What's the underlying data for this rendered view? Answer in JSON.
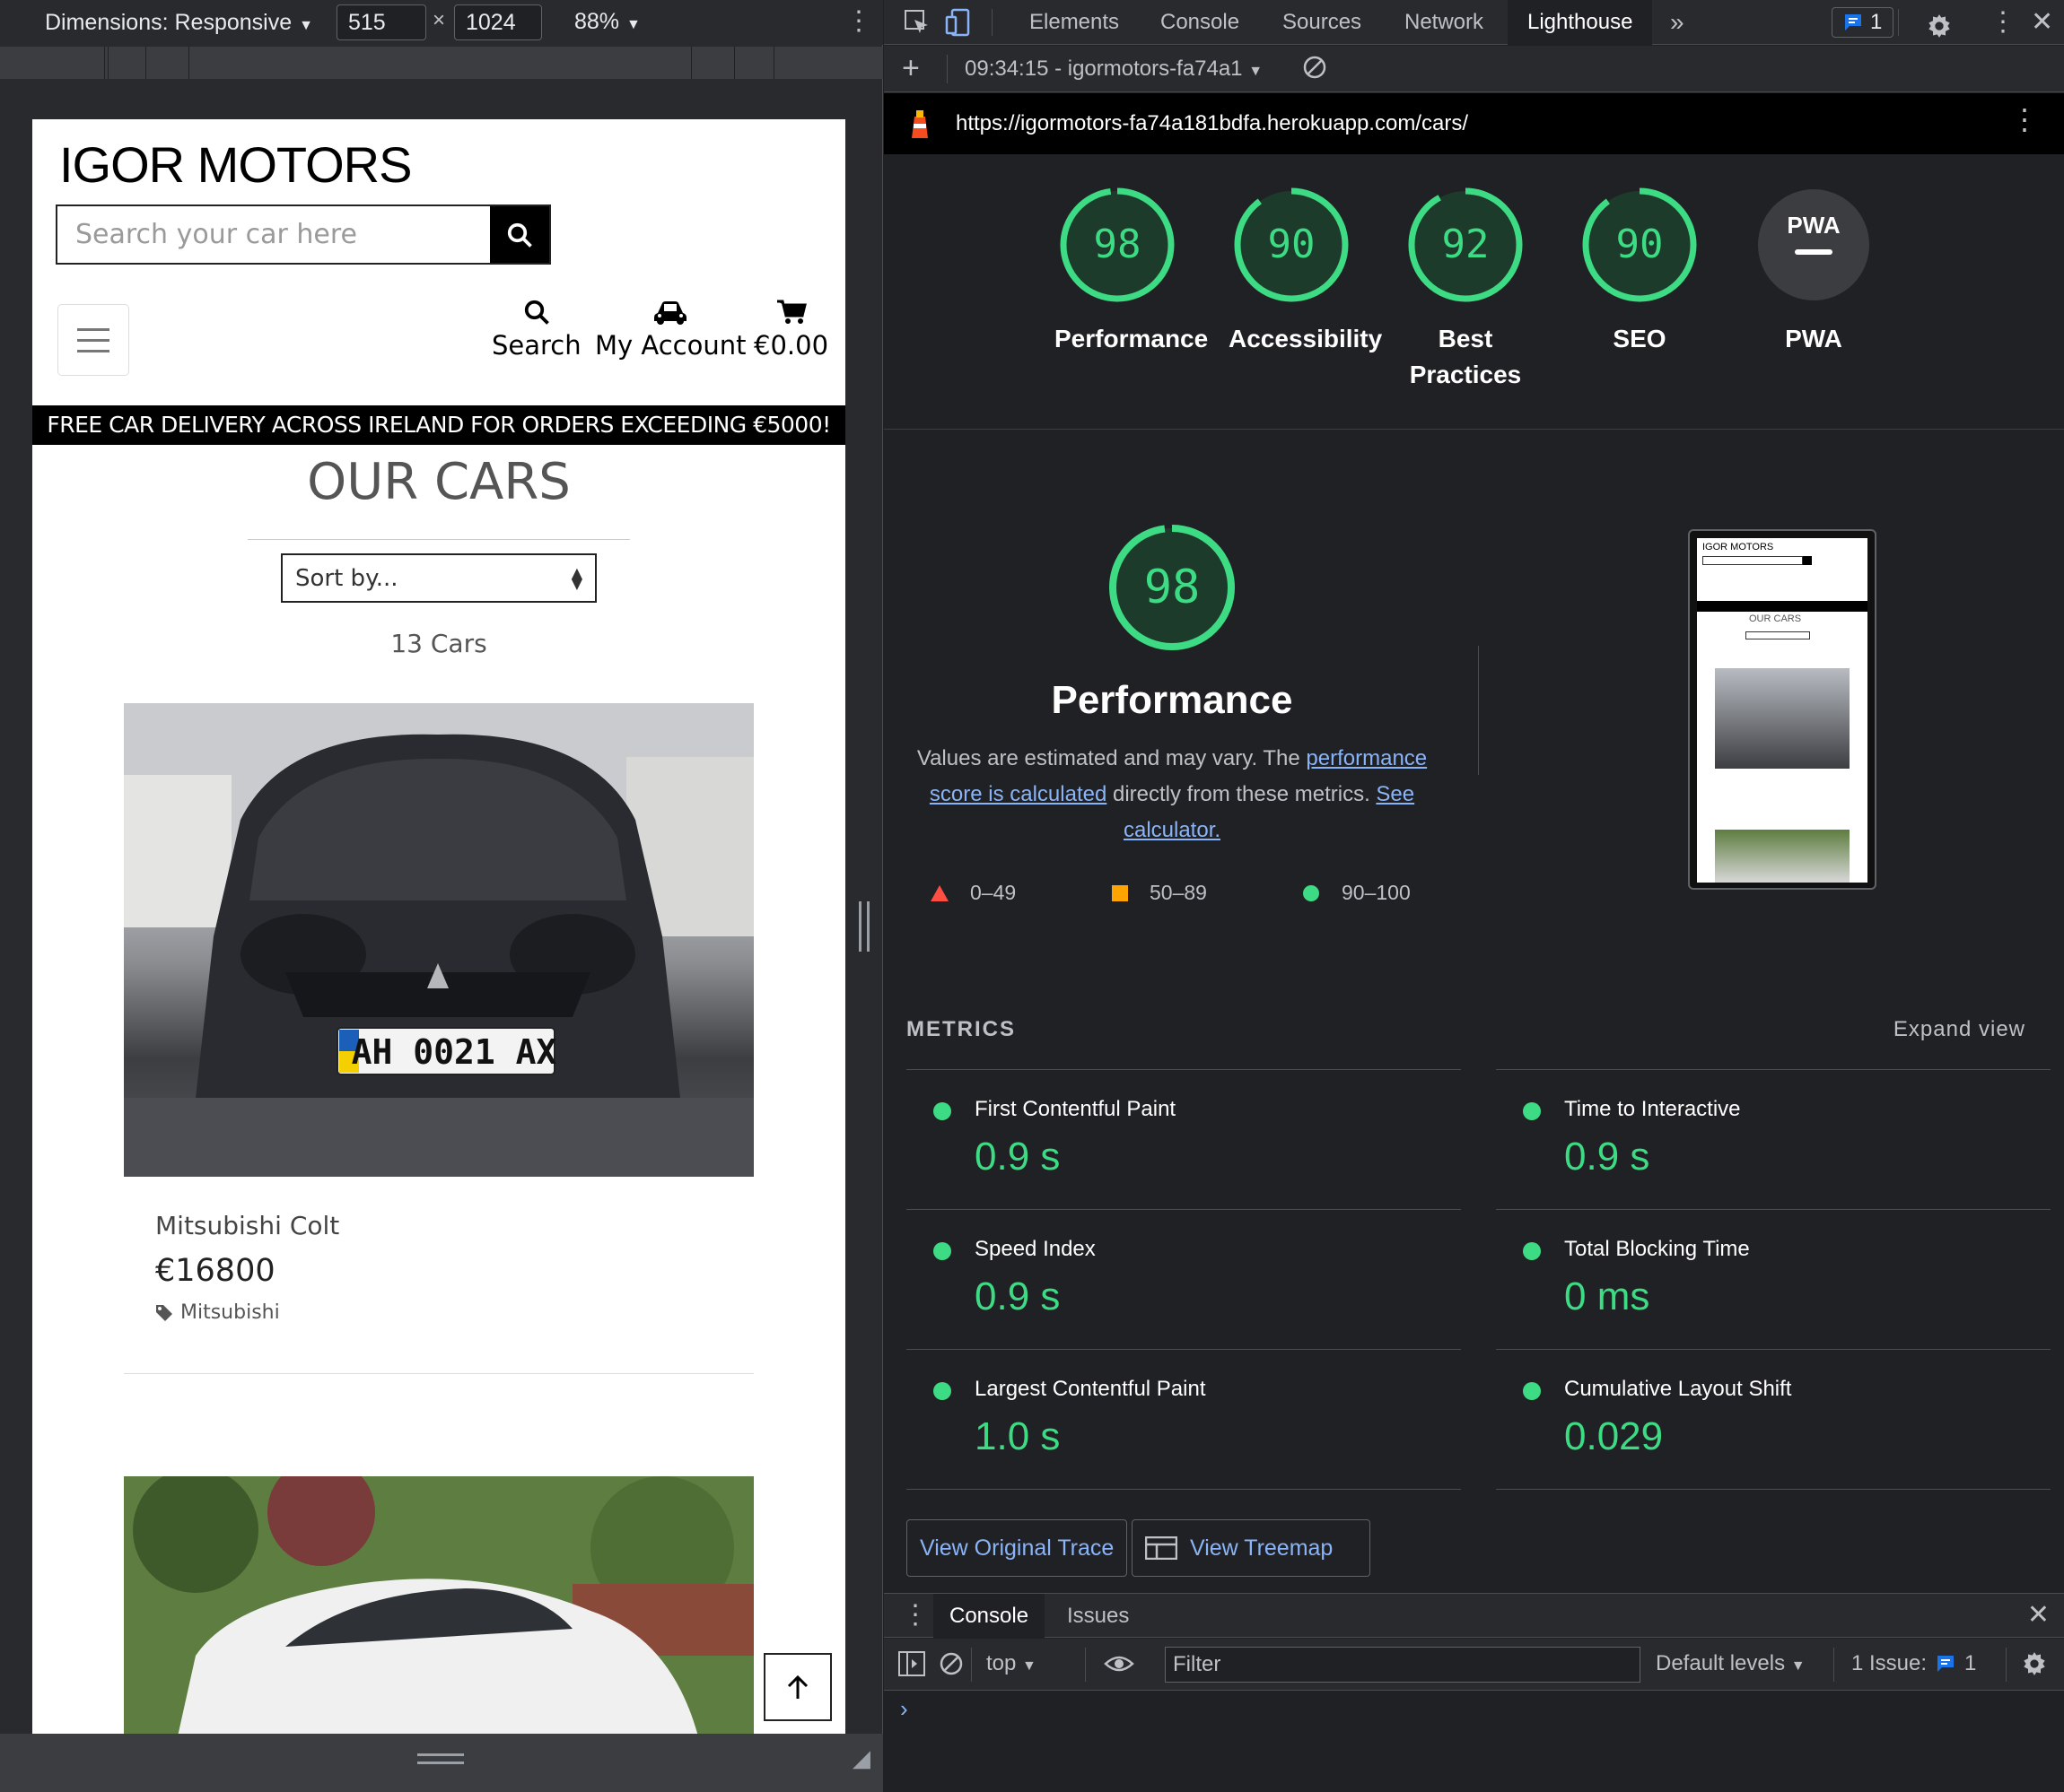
{
  "device_toolbar": {
    "dimensions_label": "Dimensions: Responsive",
    "width": "515",
    "height": "1024",
    "zoom": "88%"
  },
  "site": {
    "brand": "IGOR MOTORS",
    "search_placeholder": "Search your car here",
    "nav": {
      "search_label": "Search",
      "account_label": "My Account",
      "cart_label": "€0.00"
    },
    "banner": "FREE CAR DELIVERY ACROSS IRELAND FOR ORDERS EXCEEDING €5000!",
    "page_title": "OUR CARS",
    "sort_placeholder": "Sort by...",
    "car_count": "13 Cars",
    "cars": [
      {
        "name": "Mitsubishi Colt",
        "price": "€16800",
        "category": "Mitsubishi",
        "plate": "AH 0021 AX"
      }
    ]
  },
  "devtools": {
    "tabs": [
      "Elements",
      "Console",
      "Sources",
      "Network",
      "Lighthouse"
    ],
    "active_tab": "Lighthouse",
    "issues_count": "1",
    "report_selector": "09:34:15 - igormotors-fa74a1",
    "url": "https://igormotors-fa74a181bdfa.herokuapp.com/cars/",
    "scores": [
      {
        "label": "Performance",
        "value": "98"
      },
      {
        "label": "Accessibility",
        "value": "90"
      },
      {
        "label": "Best Practices",
        "value": "92"
      },
      {
        "label": "SEO",
        "value": "90"
      },
      {
        "label": "PWA",
        "value": ""
      }
    ],
    "pwa_badge": "PWA",
    "performance": {
      "score": "98",
      "title": "Performance",
      "desc_prefix": "Values are estimated and may vary. The ",
      "desc_link1": "performance score is calculated",
      "desc_middle": " directly from these metrics. ",
      "desc_link2": "See calculator."
    },
    "legend": [
      "0–49",
      "50–89",
      "90–100"
    ],
    "metrics_heading": "METRICS",
    "expand_view": "Expand view",
    "metrics": [
      {
        "name": "First Contentful Paint",
        "value": "0.9 s"
      },
      {
        "name": "Time to Interactive",
        "value": "0.9 s"
      },
      {
        "name": "Speed Index",
        "value": "0.9 s"
      },
      {
        "name": "Total Blocking Time",
        "value": "0 ms"
      },
      {
        "name": "Largest Contentful Paint",
        "value": "1.0 s"
      },
      {
        "name": "Cumulative Layout Shift",
        "value": "0.029"
      }
    ],
    "buttons": {
      "trace": "View Original Trace",
      "treemap": "View Treemap"
    },
    "drawer": {
      "tabs": [
        "Console",
        "Issues"
      ],
      "context": "top",
      "filter_placeholder": "Filter",
      "levels": "Default levels",
      "issues_label": "1 Issue:",
      "issues_count": "1"
    },
    "colors": {
      "pass": "#3ddc84",
      "average": "#ffa400",
      "fail": "#ff4e42",
      "link": "#8ab4f8"
    }
  }
}
